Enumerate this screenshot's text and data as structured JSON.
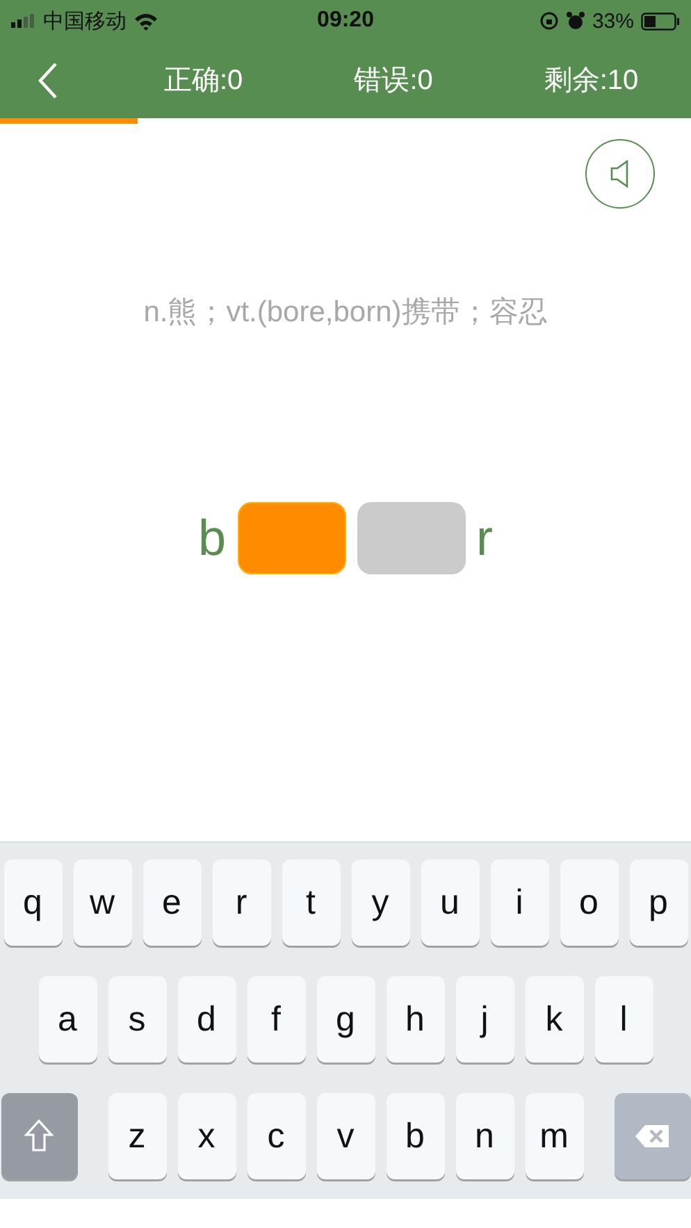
{
  "status_bar": {
    "carrier": "中国移动",
    "time": "09:20",
    "battery": "33%"
  },
  "header": {
    "stats": [
      "正确:0",
      "错误:0",
      "剩余:10"
    ]
  },
  "progress": {
    "level": 0.2
  },
  "definition": "n.熊；vt.(bore,born)携带；容忍",
  "word": [
    {
      "kind": "letter",
      "text": "b"
    },
    {
      "kind": "blank",
      "selected": true
    },
    {
      "kind": "blank",
      "selected": false
    },
    {
      "kind": "letter",
      "text": "r"
    }
  ],
  "keyboard": {
    "rows": [
      [
        "q",
        "w",
        "e",
        "r",
        "t",
        "y",
        "u",
        "i",
        "o",
        "p"
      ],
      [
        "a",
        "s",
        "d",
        "f",
        "g",
        "h",
        "j",
        "k",
        "l"
      ],
      [
        "z",
        "x",
        "c",
        "v",
        "b",
        "n",
        "m"
      ]
    ]
  }
}
